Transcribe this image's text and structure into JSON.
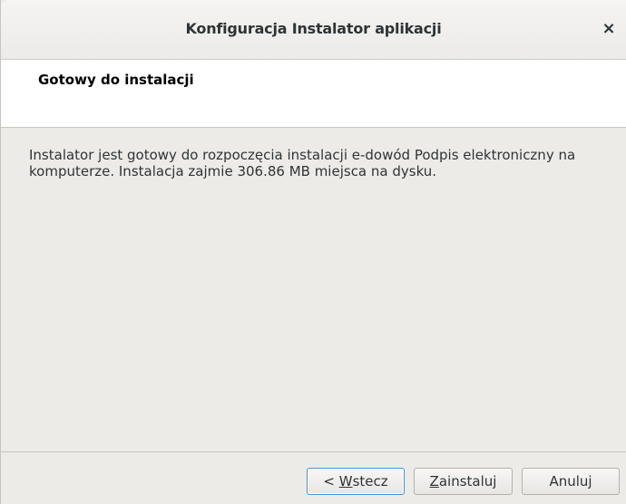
{
  "window": {
    "title": "Konfiguracja Instalator aplikacji",
    "close_glyph": "×"
  },
  "header": {
    "title": "Gotowy do instalacji"
  },
  "body": {
    "message": "Instalator jest gotowy do rozpoczęcia instalacji e-dowód Podpis elektroniczny na komputerze. Instalacja zajmie 306.86 MB miejsca na dysku."
  },
  "buttons": {
    "back": {
      "prefix": "< ",
      "mnemonic": "W",
      "rest": "stecz"
    },
    "install": {
      "prefix": "",
      "mnemonic": "Z",
      "rest": "ainstaluj"
    },
    "cancel": {
      "label": "Anuluj"
    }
  },
  "colors": {
    "window_bg": "#edebe8",
    "header_bg": "#ffffff",
    "focus_border": "#4a90d9",
    "text": "#2e3436"
  },
  "icons": {
    "close": "close-icon"
  }
}
